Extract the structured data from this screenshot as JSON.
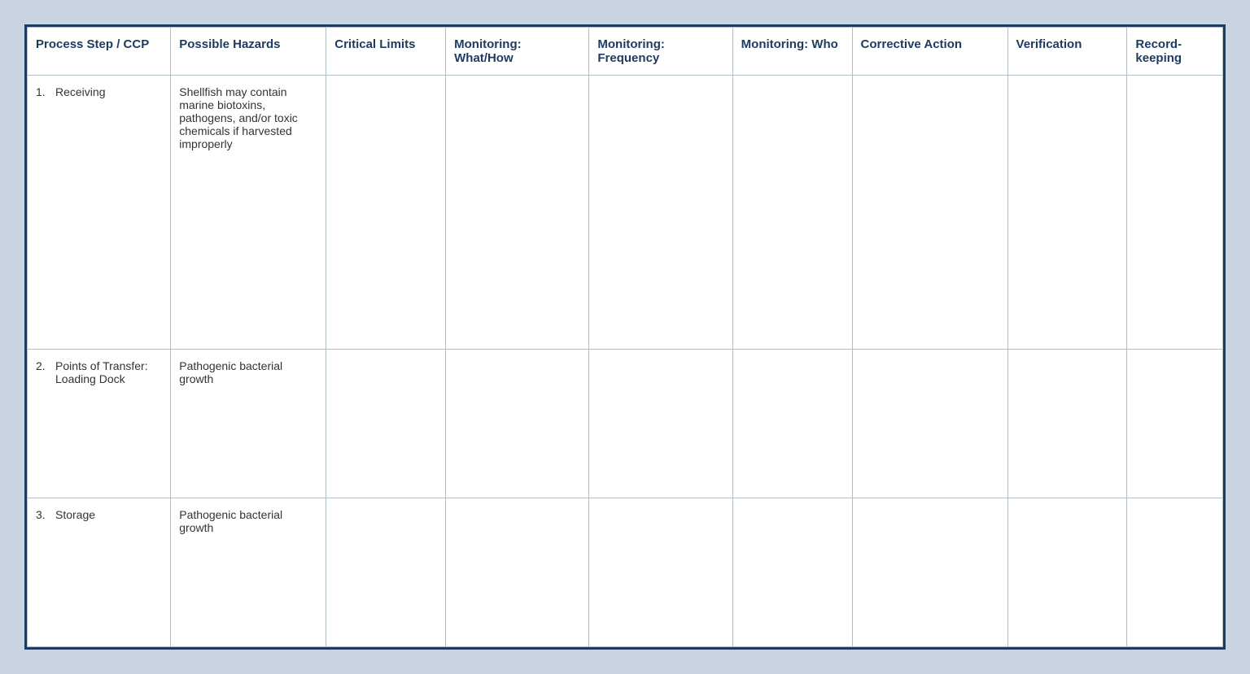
{
  "table": {
    "headers": [
      {
        "id": "process-step",
        "label": "Process Step / CCP"
      },
      {
        "id": "possible-hazards",
        "label": "Possible Hazards"
      },
      {
        "id": "critical-limits",
        "label": "Critical Limits"
      },
      {
        "id": "monitoring-what",
        "label": "Monitoring: What/How"
      },
      {
        "id": "monitoring-freq",
        "label": "Monitoring: Frequency"
      },
      {
        "id": "monitoring-who",
        "label": "Monitoring: Who"
      },
      {
        "id": "corrective-action",
        "label": "Corrective Action"
      },
      {
        "id": "verification",
        "label": "Verification"
      },
      {
        "id": "recordkeeping",
        "label": "Record-keeping"
      }
    ],
    "rows": [
      {
        "step_number": "1.",
        "step_name": "Receiving",
        "hazard": "Shellfish may contain marine biotoxins, pathogens, and/or toxic chemicals if harvested improperly",
        "critical_limits": "",
        "monitoring_what": "",
        "monitoring_freq": "",
        "monitoring_who": "",
        "corrective_action": "",
        "verification": "",
        "recordkeeping": ""
      },
      {
        "step_number": "2.",
        "step_name": "Points of Transfer: Loading Dock",
        "hazard": "Pathogenic bacterial growth",
        "critical_limits": "",
        "monitoring_what": "",
        "monitoring_freq": "",
        "monitoring_who": "",
        "corrective_action": "",
        "verification": "",
        "recordkeeping": ""
      },
      {
        "step_number": "3.",
        "step_name": "Storage",
        "hazard": "Pathogenic bacterial growth",
        "critical_limits": "",
        "monitoring_what": "",
        "monitoring_freq": "",
        "monitoring_who": "",
        "corrective_action": "",
        "verification": "",
        "recordkeeping": ""
      }
    ]
  }
}
